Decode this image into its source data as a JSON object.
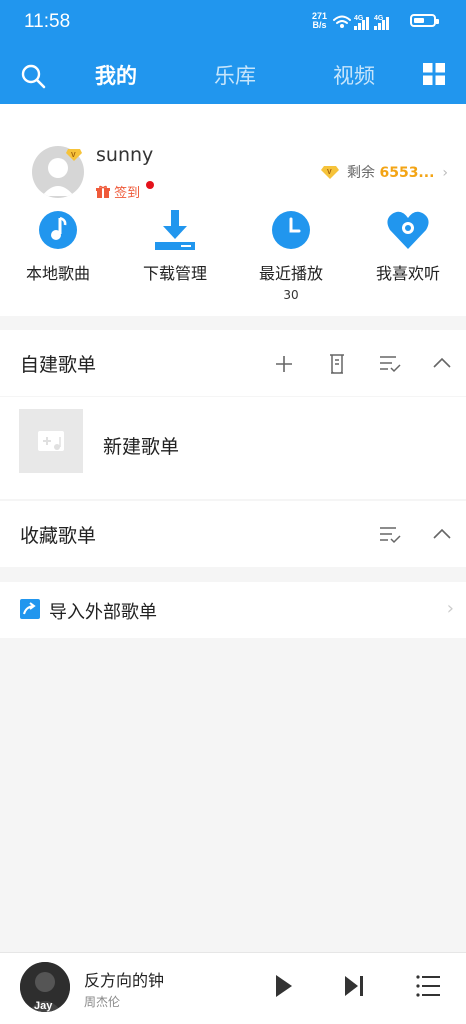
{
  "status_bar": {
    "time": "11:58",
    "speed_value": "271",
    "speed_unit": "B/s",
    "battery_level": 0.55
  },
  "nav": {
    "tabs": [
      {
        "label": "我的",
        "active": true
      },
      {
        "label": "乐库",
        "active": false
      },
      {
        "label": "视频",
        "active": false
      }
    ]
  },
  "profile": {
    "username": "sunny",
    "signin_label": "签到",
    "points_label": "剩余",
    "points_value": "6553..."
  },
  "quick_actions": [
    {
      "label": "本地歌曲",
      "icon": "music-note-icon"
    },
    {
      "label": "下载管理",
      "icon": "download-icon"
    },
    {
      "label": "最近播放",
      "icon": "clock-icon",
      "count": "30"
    },
    {
      "label": "我喜欢听",
      "icon": "heart-icon"
    }
  ],
  "created_playlists": {
    "title": "自建歌单",
    "items": [
      {
        "name": "新建歌单"
      }
    ]
  },
  "collected_playlists": {
    "title": "收藏歌单"
  },
  "import": {
    "label": "导入外部歌单"
  },
  "player": {
    "song": "反方向的钟",
    "artist": "周杰伦",
    "cover_text": "Jay"
  },
  "colors": {
    "primary": "#2196ee",
    "accent_gold": "#f3a415",
    "signin_red": "#ef5a3a"
  }
}
